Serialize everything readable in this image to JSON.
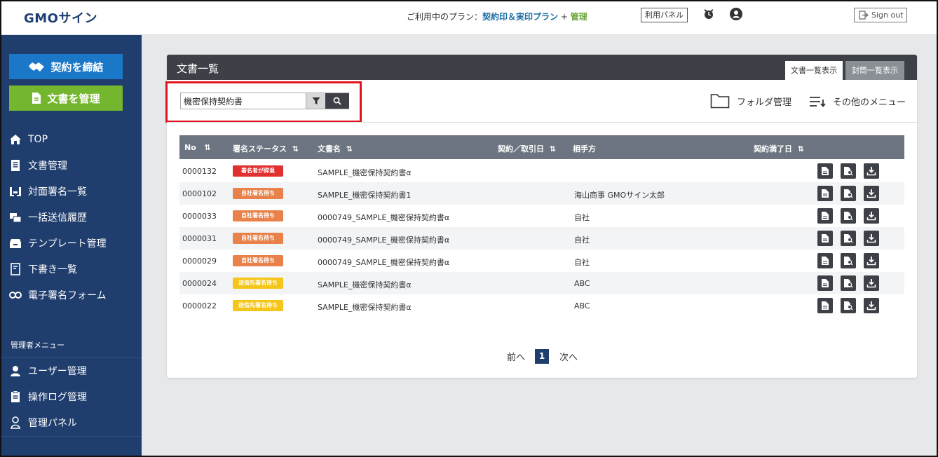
{
  "header": {
    "logo": "GMOサイン",
    "plan_prefix": "ご利用中のプラン：",
    "plan_name": "契約印＆実印プラン",
    "plan_plus": " + ",
    "plan_admin": "管理",
    "panel_button": "利用パネル",
    "signout": "Sign out"
  },
  "sidebar": {
    "contract_button": "契約を締結",
    "docs_button": "文書を管理",
    "nav": [
      {
        "label": "TOP"
      },
      {
        "label": "文書管理"
      },
      {
        "label": "対面署名一覧"
      },
      {
        "label": "一括送信履歴"
      },
      {
        "label": "テンプレート管理"
      },
      {
        "label": "下書き一覧"
      },
      {
        "label": "電子署名フォーム"
      }
    ],
    "admin_title": "管理者メニュー",
    "admin_nav": [
      {
        "label": "ユーザー管理"
      },
      {
        "label": "操作ログ管理"
      },
      {
        "label": "管理パネル"
      }
    ]
  },
  "main": {
    "title": "文書一覧",
    "tabs": [
      {
        "label": "文書一覧表示"
      },
      {
        "label": "封筒一覧表示"
      }
    ],
    "search_value": "機密保持契約書",
    "folder_label": "フォルダ管理",
    "menu_label": "その他のメニュー",
    "columns": [
      "No",
      "署名ステータス",
      "文書名",
      "契約／取引日",
      "相手方",
      "契約満了日"
    ],
    "rows": [
      {
        "no": "0000132",
        "status": "署名者が辞退",
        "doc": "SAMPLE_機密保持契約書α",
        "party": ""
      },
      {
        "no": "0000102",
        "status": "自社署名待ち",
        "doc": "SAMPLE_機密保持契約書1",
        "party": "海山商事 GMOサイン太郎"
      },
      {
        "no": "0000033",
        "status": "自社署名待ち",
        "doc": "0000749_SAMPLE_機密保持契約書α",
        "party": "自社"
      },
      {
        "no": "0000031",
        "status": "自社署名待ち",
        "doc": "0000749_SAMPLE_機密保持契約書α",
        "party": "自社"
      },
      {
        "no": "0000029",
        "status": "自社署名待ち",
        "doc": "0000749_SAMPLE_機密保持契約書α",
        "party": "自社"
      },
      {
        "no": "0000024",
        "status": "送信先署名待ち",
        "doc": "SAMPLE_機密保持契約書α",
        "party": "ABC"
      },
      {
        "no": "0000022",
        "status": "送信先署名待ち",
        "doc": "SAMPLE_機密保持契約書α",
        "party": "ABC"
      }
    ],
    "pagination": {
      "prev": "前へ",
      "current": "1",
      "next": "次へ"
    }
  },
  "colors": {
    "sidebar": "#1f3d6d",
    "contract_button": "#1b78c8",
    "docs_button": "#74b62e",
    "declined": "#e03131",
    "self_waiting": "#e8824a",
    "recipient_waiting": "#f5c518",
    "highlight": "#e0141e"
  }
}
